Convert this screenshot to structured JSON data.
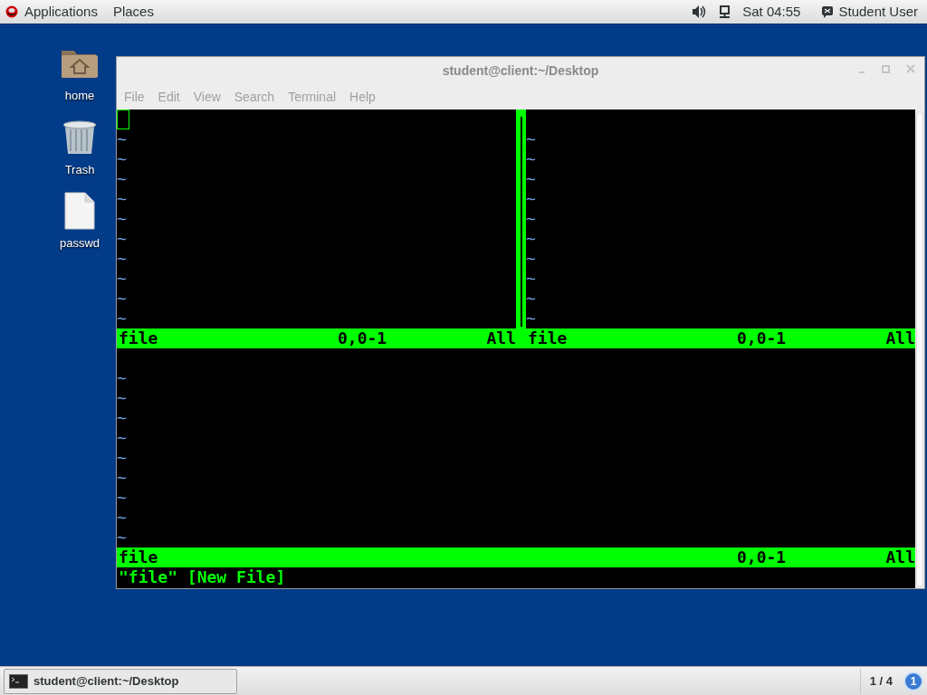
{
  "top_bar": {
    "menus": [
      "Applications",
      "Places"
    ],
    "clock": "Sat 04:55",
    "user": "Student User"
  },
  "desktop_icons": [
    {
      "label": "home",
      "kind": "folder"
    },
    {
      "label": "Trash",
      "kind": "trash"
    },
    {
      "label": "passwd",
      "kind": "file"
    }
  ],
  "window": {
    "title": "student@client:~/Desktop",
    "menu": [
      "File",
      "Edit",
      "View",
      "Search",
      "Terminal",
      "Help"
    ]
  },
  "vim": {
    "top_panes": [
      {
        "cursor": true,
        "tildes": [
          "~",
          "~",
          "~",
          "~",
          "~",
          "~",
          "~",
          "~",
          "~",
          "~"
        ],
        "status": {
          "name": "file",
          "position": "0,0-1",
          "scroll": "All"
        }
      },
      {
        "tildes": [
          "~",
          "~",
          "~",
          "~",
          "~",
          "~",
          "~",
          "~",
          "~",
          "~"
        ],
        "status": {
          "name": "file",
          "position": "0,0-1",
          "scroll": "All"
        }
      }
    ],
    "bottom_pane": {
      "tildes": [
        "~",
        "~",
        "~",
        "~",
        "~",
        "~",
        "~",
        "~",
        "~"
      ],
      "status": {
        "name": "file",
        "position": "0,0-1",
        "scroll": "All"
      }
    },
    "command_line": "\"file\" [New File]"
  },
  "taskbar": {
    "task": "student@client:~/Desktop",
    "workspace": "1 / 4",
    "notifications": "1"
  }
}
